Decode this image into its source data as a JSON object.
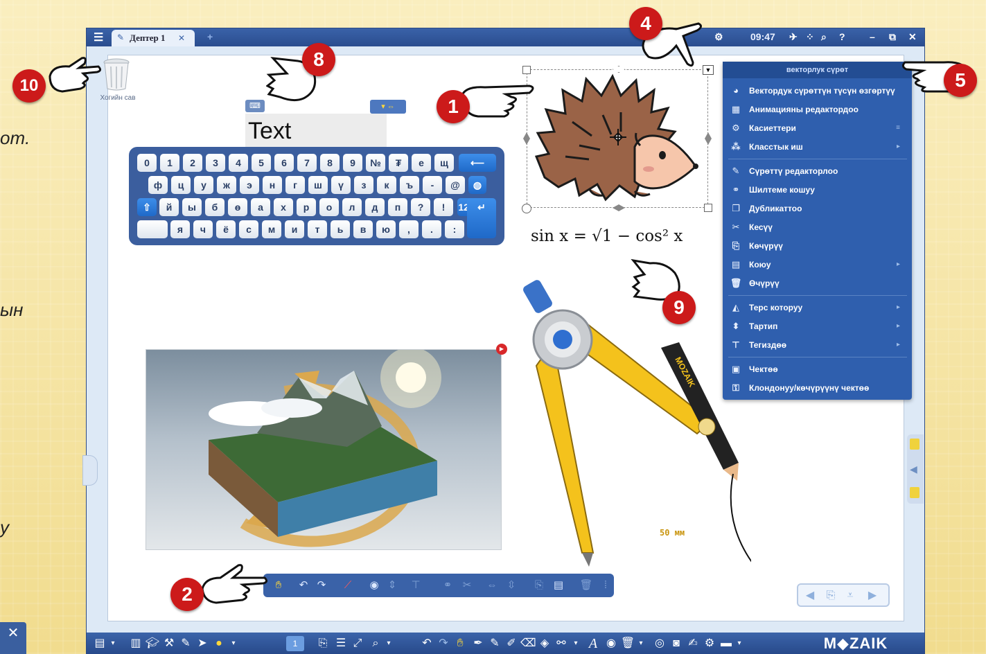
{
  "left_text": {
    "line1": "om.",
    "line2": "ын",
    "line3": "у"
  },
  "closebox": {
    "label": "✕"
  },
  "titlebar": {
    "tab_label": "Дептер 1",
    "tab_close": "✕",
    "new_tab": "+",
    "time": "09:47",
    "question": "?",
    "minimize": "–",
    "close": "✕"
  },
  "trash": {
    "label": "Хогийн сав"
  },
  "textbox": {
    "value": "Text"
  },
  "formula": {
    "text": "sin x = √1 − cos² x"
  },
  "ruler_label": "50 мм",
  "compass_brand": "MOZAIK",
  "keyboard": {
    "row1": [
      "0",
      "1",
      "2",
      "3",
      "4",
      "5",
      "6",
      "7",
      "8",
      "9",
      "№",
      "₮",
      "е",
      "щ"
    ],
    "row1_backspace": "⟵",
    "row2": [
      "ф",
      "ц",
      "у",
      "ж",
      "э",
      "н",
      "г",
      "ш",
      "ү",
      "з",
      "к",
      "ъ",
      "-",
      "@"
    ],
    "row3": [
      "й",
      "ы",
      "б",
      "ө",
      "а",
      "х",
      "р",
      "о",
      "л",
      "д",
      "п",
      "?",
      "!"
    ],
    "row3_num": "123",
    "row4": [
      "я",
      "ч",
      "ё",
      "с",
      "м",
      "и",
      "т",
      "ь",
      "в",
      "ю",
      ",",
      ".",
      ":"
    ],
    "enter": "↵"
  },
  "menu": {
    "title": "векторлук сүрөт",
    "items": [
      {
        "icon": "palette-icon",
        "label": "Вектордук сүрөттүн түсүн өзгөртүү"
      },
      {
        "icon": "film-icon",
        "label": "Анимацияны редактордоо"
      },
      {
        "icon": "gear-icon",
        "label": "Касиеттери",
        "arrow": "≡"
      },
      {
        "icon": "class-work-icon",
        "label": "Класстык иш",
        "arrow": "▸"
      },
      {
        "icon": "image-edit-icon",
        "label": "Сүрөттү редакторлоо"
      },
      {
        "icon": "link-icon",
        "label": "Шилтеме кошуу"
      },
      {
        "icon": "duplicate-icon",
        "label": "Дубликаттоо"
      },
      {
        "icon": "scissors-icon",
        "label": "Кесүү"
      },
      {
        "icon": "copy-icon",
        "label": "Көчүрүү"
      },
      {
        "icon": "paste-icon",
        "label": "Коюу",
        "arrow": "▸"
      },
      {
        "icon": "trash-icon",
        "label": "Өчүрүү"
      },
      {
        "icon": "flip-icon",
        "label": "Терс которуу",
        "arrow": "▸"
      },
      {
        "icon": "order-icon",
        "label": "Тартип",
        "arrow": "▸"
      },
      {
        "icon": "align-icon",
        "label": "Тегиздөө",
        "arrow": "▸"
      },
      {
        "icon": "lock-icon",
        "label": "Чектөө"
      },
      {
        "icon": "clone-lock-icon",
        "label": "Клондонуу/көчүрүүнү чектөө"
      }
    ]
  },
  "badges": [
    "1",
    "2",
    "4",
    "5",
    "8",
    "9",
    "10"
  ],
  "bottombar": {
    "page_number": "1",
    "brand": "M◆ZAIK"
  },
  "colors": {
    "window_blue": "#2a4d8f",
    "menu_blue": "#2f5fae",
    "badge_red": "#cc1a1a",
    "hedgehog_brown": "#9a6347",
    "compass_yellow": "#f4c21c"
  }
}
